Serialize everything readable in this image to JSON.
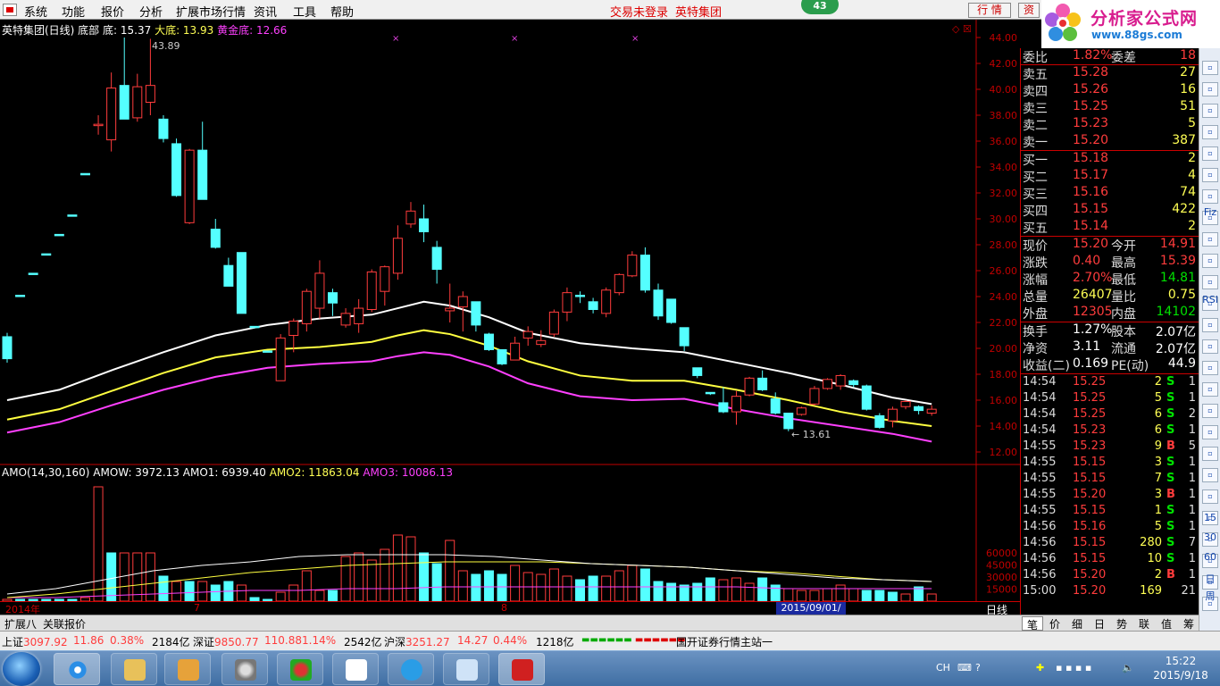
{
  "menu": {
    "items": [
      "系统",
      "功能",
      "报价",
      "分析",
      "扩展市场行情",
      "资讯",
      "工具",
      "帮助"
    ],
    "status_text": "交易未登录",
    "stock_title": "英特集团",
    "badge": "43",
    "btn_quote": "行 情",
    "btn_info": "资"
  },
  "logo": {
    "name": "分析家公式网",
    "url": "www.88gs.com"
  },
  "chart": {
    "info": {
      "name": "英特集团(日线) 底部",
      "di": "底: 15.37",
      "dadi": "大底: 13.93",
      "huangjin": "黄金底: 12.66"
    },
    "peak_label": "43.89",
    "low_label": "← 13.61",
    "yaxis": [
      "44.00",
      "42.00",
      "40.00",
      "38.00",
      "36.00",
      "34.00",
      "32.00",
      "30.00",
      "28.00",
      "26.00",
      "24.00",
      "22.00",
      "20.00",
      "18.00",
      "16.00",
      "14.00",
      "12.00"
    ],
    "amo": {
      "title": "AMO(14,30,160)",
      "amow": "AMOW: 3972.13",
      "amo1": "AMO1: 6939.40",
      "amo2": "AMO2: 11863.04",
      "amo3": "AMO3: 10086.13",
      "yaxis": [
        "60000",
        "45000",
        "30000",
        "15000"
      ]
    },
    "xaxis": {
      "start": "2014年",
      "m1": "7",
      "m2": "8",
      "date": "2015/09/01/二",
      "period": "日线"
    },
    "candles": [
      [
        20.9,
        19.2,
        21.2,
        18.9
      ],
      [
        24.1,
        24.0,
        24.1,
        24.0
      ],
      [
        25.8,
        25.7,
        25.8,
        25.7
      ],
      [
        27.3,
        27.2,
        27.3,
        27.2
      ],
      [
        28.8,
        28.7,
        28.8,
        28.7
      ],
      [
        30.3,
        30.2,
        30.3,
        30.2
      ],
      [
        33.5,
        33.4,
        33.5,
        33.4
      ],
      [
        37.3,
        37.3,
        38.0,
        36.5
      ],
      [
        36.1,
        40.1,
        41.3,
        35.2
      ],
      [
        40.3,
        37.7,
        44.0,
        37.7
      ],
      [
        37.8,
        40.2,
        41.2,
        37.5
      ],
      [
        39.0,
        40.3,
        43.9,
        38.0
      ],
      [
        37.7,
        36.2,
        38.0,
        35.9
      ],
      [
        35.8,
        31.8,
        36.2,
        31.7
      ],
      [
        29.7,
        35.3,
        35.4,
        29.6
      ],
      [
        35.3,
        31.5,
        37.5,
        31.5
      ],
      [
        29.2,
        27.8,
        30.0,
        27.7
      ],
      [
        26.4,
        24.8,
        27.0,
        24.8
      ],
      [
        27.4,
        22.7,
        27.4,
        22.7
      ],
      [
        21.7,
        21.6,
        21.7,
        21.6
      ],
      [
        19.8,
        19.7,
        19.8,
        19.7
      ],
      [
        17.5,
        20.8,
        21.1,
        17.5
      ],
      [
        21.0,
        22.1,
        22.3,
        19.7
      ],
      [
        21.9,
        24.4,
        24.6,
        21.3
      ],
      [
        23.1,
        25.8,
        26.8,
        22.3
      ],
      [
        24.3,
        23.5,
        24.6,
        22.5
      ],
      [
        21.8,
        22.7,
        23.1,
        21.6
      ],
      [
        21.9,
        23.1,
        23.8,
        21.2
      ],
      [
        23.0,
        25.9,
        26.1,
        22.8
      ],
      [
        24.4,
        26.3,
        26.4,
        23.3
      ],
      [
        25.8,
        28.5,
        29.5,
        25.3
      ],
      [
        29.6,
        30.6,
        31.3,
        29.3
      ],
      [
        30.0,
        29.0,
        31.1,
        28.2
      ],
      [
        27.8,
        26.1,
        28.3,
        25.0
      ],
      [
        22.9,
        23.1,
        25.0,
        22.0
      ],
      [
        23.2,
        24.0,
        24.4,
        21.3
      ],
      [
        23.6,
        21.8,
        23.6,
        21.3
      ],
      [
        21.1,
        19.9,
        21.2,
        19.8
      ],
      [
        19.9,
        18.8,
        19.9,
        18.7
      ],
      [
        19.1,
        20.4,
        20.9,
        19.1
      ],
      [
        20.8,
        21.3,
        21.7,
        20.2
      ],
      [
        20.3,
        20.6,
        21.4,
        20.1
      ],
      [
        21.1,
        22.8,
        23.0,
        20.9
      ],
      [
        22.8,
        24.3,
        24.7,
        22.1
      ],
      [
        24.1,
        24.0,
        24.4,
        23.5
      ],
      [
        23.6,
        23.0,
        23.9,
        22.7
      ],
      [
        22.7,
        24.5,
        24.7,
        22.4
      ],
      [
        24.3,
        25.7,
        25.8,
        24.1
      ],
      [
        25.6,
        27.2,
        27.5,
        25.5
      ],
      [
        27.2,
        24.5,
        27.8,
        24.3
      ],
      [
        24.5,
        22.5,
        25.0,
        22.2
      ],
      [
        23.8,
        22.0,
        23.8,
        21.9
      ],
      [
        21.6,
        20.2,
        21.6,
        19.8
      ],
      [
        18.5,
        17.9,
        18.5,
        17.7
      ],
      [
        16.6,
        16.5,
        16.6,
        16.4
      ],
      [
        15.8,
        15.1,
        17.0,
        15.0
      ],
      [
        15.1,
        16.3,
        16.7,
        14.1
      ],
      [
        16.4,
        17.7,
        17.8,
        16.3
      ],
      [
        17.7,
        16.8,
        18.3,
        16.7
      ],
      [
        16.1,
        15.0,
        16.6,
        14.9
      ],
      [
        15.0,
        13.8,
        15.0,
        13.6
      ],
      [
        14.9,
        15.4,
        15.5,
        14.8
      ],
      [
        15.7,
        16.9,
        17.1,
        15.6
      ],
      [
        16.9,
        17.6,
        17.7,
        16.8
      ],
      [
        17.1,
        17.9,
        18.0,
        16.8
      ],
      [
        17.5,
        17.2,
        17.6,
        17.0
      ],
      [
        17.1,
        15.3,
        17.2,
        15.2
      ],
      [
        14.8,
        13.9,
        15.0,
        13.8
      ],
      [
        14.4,
        15.3,
        15.5,
        13.9
      ],
      [
        15.5,
        15.9,
        16.0,
        15.3
      ],
      [
        15.5,
        15.2,
        15.6,
        14.9
      ],
      [
        15.0,
        15.3,
        15.6,
        14.8
      ]
    ],
    "volumes": [
      [
        1,
        1
      ],
      [
        0,
        1
      ],
      [
        0,
        1
      ],
      [
        0,
        1
      ],
      [
        0,
        1
      ],
      [
        0,
        1
      ],
      [
        1,
        2
      ],
      [
        1,
        64
      ],
      [
        0,
        27
      ],
      [
        1,
        27
      ],
      [
        1,
        27
      ],
      [
        1,
        27
      ],
      [
        0,
        14
      ],
      [
        1,
        11
      ],
      [
        0,
        11
      ],
      [
        1,
        11
      ],
      [
        0,
        9
      ],
      [
        0,
        11
      ],
      [
        1,
        9
      ],
      [
        0,
        2
      ],
      [
        0,
        1
      ],
      [
        1,
        5
      ],
      [
        1,
        9
      ],
      [
        1,
        17
      ],
      [
        1,
        6
      ],
      [
        0,
        6
      ],
      [
        1,
        25
      ],
      [
        1,
        27
      ],
      [
        1,
        23
      ],
      [
        1,
        29
      ],
      [
        1,
        37
      ],
      [
        1,
        36
      ],
      [
        0,
        27
      ],
      [
        0,
        21
      ],
      [
        1,
        34
      ],
      [
        1,
        17
      ],
      [
        0,
        15
      ],
      [
        0,
        17
      ],
      [
        0,
        15
      ],
      [
        1,
        20
      ],
      [
        1,
        16
      ],
      [
        1,
        15
      ],
      [
        1,
        18
      ],
      [
        1,
        14
      ],
      [
        0,
        12
      ],
      [
        0,
        14
      ],
      [
        1,
        14
      ],
      [
        1,
        17
      ],
      [
        1,
        20
      ],
      [
        0,
        18
      ],
      [
        0,
        11
      ],
      [
        0,
        10
      ],
      [
        0,
        9
      ],
      [
        0,
        10
      ],
      [
        0,
        13
      ],
      [
        1,
        12
      ],
      [
        1,
        13
      ],
      [
        1,
        10
      ],
      [
        0,
        13
      ],
      [
        0,
        9
      ],
      [
        1,
        7
      ],
      [
        1,
        6
      ],
      [
        1,
        6
      ],
      [
        1,
        7
      ],
      [
        1,
        9
      ],
      [
        1,
        7
      ],
      [
        0,
        6
      ],
      [
        0,
        6
      ],
      [
        0,
        5
      ],
      [
        1,
        4
      ],
      [
        0,
        8
      ],
      [
        1,
        4
      ]
    ],
    "lines": {
      "white": [
        [
          0,
          16.0
        ],
        [
          4,
          16.8
        ],
        [
          8,
          18.3
        ],
        [
          12,
          19.7
        ],
        [
          16,
          21.0
        ],
        [
          20,
          21.8
        ],
        [
          24,
          22.3
        ],
        [
          28,
          22.6
        ],
        [
          30,
          23.1
        ],
        [
          32,
          23.6
        ],
        [
          34,
          23.3
        ],
        [
          37,
          22.4
        ],
        [
          40,
          21.2
        ],
        [
          44,
          20.4
        ],
        [
          48,
          20.0
        ],
        [
          52,
          19.7
        ],
        [
          56,
          18.9
        ],
        [
          60,
          18.1
        ],
        [
          64,
          17.2
        ],
        [
          68,
          16.2
        ],
        [
          71,
          15.7
        ]
      ],
      "yellow": [
        [
          0,
          14.5
        ],
        [
          4,
          15.3
        ],
        [
          8,
          16.7
        ],
        [
          12,
          18.1
        ],
        [
          16,
          19.3
        ],
        [
          20,
          19.9
        ],
        [
          24,
          20.1
        ],
        [
          28,
          20.5
        ],
        [
          30,
          21.0
        ],
        [
          32,
          21.4
        ],
        [
          34,
          21.1
        ],
        [
          37,
          20.2
        ],
        [
          40,
          19.0
        ],
        [
          44,
          17.9
        ],
        [
          48,
          17.5
        ],
        [
          52,
          17.5
        ],
        [
          56,
          16.8
        ],
        [
          60,
          16.0
        ],
        [
          64,
          15.1
        ],
        [
          68,
          14.4
        ],
        [
          71,
          14.0
        ]
      ],
      "magenta": [
        [
          0,
          13.5
        ],
        [
          4,
          14.3
        ],
        [
          8,
          15.6
        ],
        [
          12,
          16.8
        ],
        [
          16,
          17.8
        ],
        [
          20,
          18.5
        ],
        [
          24,
          18.8
        ],
        [
          28,
          19.0
        ],
        [
          30,
          19.4
        ],
        [
          32,
          19.7
        ],
        [
          34,
          19.5
        ],
        [
          37,
          18.6
        ],
        [
          40,
          17.3
        ],
        [
          44,
          16.3
        ],
        [
          48,
          16.0
        ],
        [
          52,
          16.1
        ],
        [
          56,
          15.3
        ],
        [
          60,
          14.6
        ],
        [
          64,
          14.0
        ],
        [
          68,
          13.4
        ],
        [
          71,
          12.8
        ]
      ]
    },
    "amo_lines": {
      "white": [
        4,
        7,
        12,
        17,
        20,
        22,
        25,
        26,
        26,
        26,
        25,
        23,
        21,
        20,
        19,
        17,
        15,
        13,
        12,
        11
      ],
      "yellow": [
        2,
        4,
        7,
        10,
        13,
        16,
        18,
        20,
        21,
        22,
        22,
        22,
        21,
        20,
        19,
        17,
        16,
        14,
        12,
        11
      ],
      "magenta": [
        2,
        2,
        3,
        4,
        5,
        6,
        6,
        7,
        7,
        8,
        8,
        8,
        8,
        8,
        8,
        8,
        7,
        7,
        7,
        7
      ]
    }
  },
  "bottom_tabs": [
    "扩展八",
    "关联报价"
  ],
  "quote": {
    "weibi": {
      "label": "委比",
      "value": "1.82%",
      "label2": "委差",
      "value2": "18"
    },
    "sell": [
      {
        "label": "卖五",
        "price": "15.28",
        "vol": "27"
      },
      {
        "label": "卖四",
        "price": "15.26",
        "vol": "16"
      },
      {
        "label": "卖三",
        "price": "15.25",
        "vol": "51"
      },
      {
        "label": "卖二",
        "price": "15.23",
        "vol": "5"
      },
      {
        "label": "卖一",
        "price": "15.20",
        "vol": "387"
      }
    ],
    "buy": [
      {
        "label": "买一",
        "price": "15.18",
        "vol": "2"
      },
      {
        "label": "买二",
        "price": "15.17",
        "vol": "4"
      },
      {
        "label": "买三",
        "price": "15.16",
        "vol": "74"
      },
      {
        "label": "买四",
        "price": "15.15",
        "vol": "422"
      },
      {
        "label": "买五",
        "price": "15.14",
        "vol": "2"
      }
    ],
    "stats1": [
      {
        "l1": "现价",
        "v1": "15.20",
        "c1": "red",
        "l2": "今开",
        "v2": "14.91",
        "c2": "red"
      },
      {
        "l1": "涨跌",
        "v1": "0.40",
        "c1": "red",
        "l2": "最高",
        "v2": "15.39",
        "c2": "red"
      },
      {
        "l1": "涨幅",
        "v1": "2.70%",
        "c1": "red",
        "l2": "最低",
        "v2": "14.81",
        "c2": "grn"
      },
      {
        "l1": "总量",
        "v1": "26407",
        "c1": "yel",
        "l2": "量比",
        "v2": "0.75",
        "c2": "yel"
      },
      {
        "l1": "外盘",
        "v1": "12305",
        "c1": "red",
        "l2": "内盘",
        "v2": "14102",
        "c2": "grn"
      }
    ],
    "stats2": [
      {
        "l1": "换手",
        "v1": "1.27%",
        "l2": "股本",
        "v2": "2.07亿"
      },
      {
        "l1": "净资",
        "v1": "3.11",
        "l2": "流通",
        "v2": "2.07亿"
      },
      {
        "l1": "收益(二)",
        "v1": "0.169",
        "l2": "PE(动)",
        "v2": "44.9"
      }
    ],
    "ticks": [
      {
        "t": "14:54",
        "p": "15.25",
        "v": "2",
        "f": "S",
        "n": "1"
      },
      {
        "t": "14:54",
        "p": "15.25",
        "v": "5",
        "f": "S",
        "n": "1"
      },
      {
        "t": "14:54",
        "p": "15.25",
        "v": "6",
        "f": "S",
        "n": "2"
      },
      {
        "t": "14:54",
        "p": "15.23",
        "v": "6",
        "f": "S",
        "n": "1"
      },
      {
        "t": "14:55",
        "p": "15.23",
        "v": "9",
        "f": "B",
        "n": "5"
      },
      {
        "t": "14:55",
        "p": "15.15",
        "v": "3",
        "f": "S",
        "n": "1"
      },
      {
        "t": "14:55",
        "p": "15.15",
        "v": "7",
        "f": "S",
        "n": "1"
      },
      {
        "t": "14:55",
        "p": "15.20",
        "v": "3",
        "f": "B",
        "n": "1"
      },
      {
        "t": "14:55",
        "p": "15.15",
        "v": "1",
        "f": "S",
        "n": "1"
      },
      {
        "t": "14:56",
        "p": "15.16",
        "v": "5",
        "f": "S",
        "n": "1"
      },
      {
        "t": "14:56",
        "p": "15.15",
        "v": "280",
        "f": "S",
        "n": "7"
      },
      {
        "t": "14:56",
        "p": "15.15",
        "v": "10",
        "f": "S",
        "n": "1"
      },
      {
        "t": "14:56",
        "p": "15.20",
        "v": "2",
        "f": "B",
        "n": "1"
      },
      {
        "t": "15:00",
        "p": "15.20",
        "v": "169",
        "f": "",
        "n": "21"
      }
    ],
    "tabs": [
      "笔",
      "价",
      "细",
      "日",
      "势",
      "联",
      "值",
      "筹"
    ]
  },
  "toolbar_labels": [
    "Fiz",
    "RSI",
    "15",
    "30",
    "60",
    "日",
    "周"
  ],
  "status": {
    "sh_label": "上证",
    "sh_val": "3097.92",
    "sh_chg": "11.86",
    "sh_pct": "0.38%",
    "sh_amt": "2184亿",
    "sz_label": "深证",
    "sz_val": "9850.77",
    "sz_chg": "110.88",
    "sz_pct": "1.14%",
    "sz_amt": "2542亿",
    "hs_label": "沪深",
    "hs_val": "3251.27",
    "hs_chg": "14.27",
    "hs_pct": "0.44%",
    "hs_amt": "1218亿",
    "msg": "国开证券行情主站一"
  },
  "taskbar": {
    "lang": "CH",
    "time": "15:22",
    "date": "2015/9/18"
  },
  "colors": {
    "up": "#ff3c3c",
    "down": "#54ffff",
    "white_line": "#ffffff",
    "yellow_line": "#ffff40",
    "magenta_line": "#ff40ff",
    "grid": "#c00000"
  }
}
